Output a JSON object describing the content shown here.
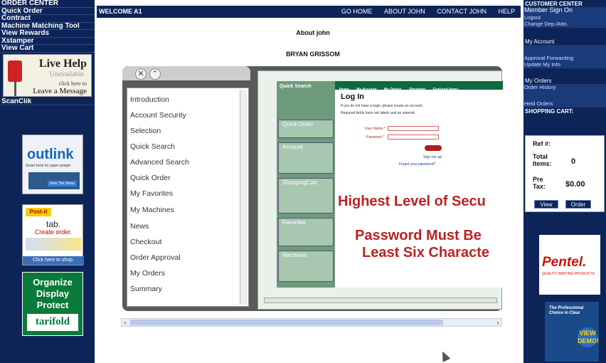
{
  "left_nav": {
    "items": [
      "ORDER CENTER",
      "Quick Order",
      "Contract",
      "Machine Matching Tool",
      "View Rewards",
      "Xstamper",
      "View Cart"
    ],
    "live_help": {
      "title": "Live Help",
      "status": "Unavailable",
      "cta_small": "click here to",
      "cta": "Leave a Message"
    },
    "scanclik": "ScanClik"
  },
  "ads_left": {
    "outlink": {
      "logo": "outlink",
      "tagline": "Smart tools for paper people",
      "demo": "View The Demo"
    },
    "postit": {
      "brand": "Post-it",
      "suffix": "Flags",
      "tab": "tab.",
      "create": "Create order.",
      "shop": "Click here to shop."
    },
    "tarifold": {
      "line1": "Organize",
      "line2": "Display",
      "line3": "Protect",
      "brand": "tarifold"
    }
  },
  "top_bar": {
    "welcome": "WELCOME A1",
    "links": [
      "GO HOME",
      "ABOUT JOHN",
      "CONTACT JOHN",
      "HELP"
    ]
  },
  "main": {
    "title": "About john",
    "subtitle": "BRYAN GRISSOM",
    "toc": [
      "Introduction",
      "Account Security",
      "Selection",
      "Quick Search",
      "Advanced Search",
      "Quick Order",
      "My Favorites",
      "My Machines",
      "News",
      "Checkout",
      "Order Approval",
      "My Orders",
      "Summary"
    ],
    "shot": {
      "nav": [
        "Home",
        "My Account",
        "My Orders",
        "Shopping",
        "Featured Items"
      ],
      "quick_search": "Quick Search",
      "panels": [
        "Quick Order",
        "Account",
        "ShoppingCart",
        "Favorites",
        "Machines"
      ],
      "login_title": "Log In",
      "login_note": "If you do not have a login, please create an account.",
      "required_note": "Required fields have red labels and an asterisk.",
      "user_label": "User Name *",
      "password_label": "Password *",
      "sign_up": "Sign me up!",
      "forgot": "Forgot your password?",
      "big1": "Highest Level of Secu",
      "big2": "Password Must Be",
      "big3": "Least Six Characte"
    }
  },
  "right_nav": {
    "customer_center": "CUSTOMER CENTER",
    "links_a": [
      "Member Sign On",
      "Logout",
      "Change Dep./Attn."
    ],
    "my_account": "My Account",
    "links_b": [
      "Approval Forwarding",
      "Update My Info"
    ],
    "my_orders": "My Orders",
    "links_c": [
      "Order History",
      "Held Orders"
    ],
    "shopping_cart": "SHOPPING CART:",
    "cart": {
      "ref": "Ref #:",
      "total_label": "Total Items:",
      "total_value": "0",
      "pretax_label": "Pre Tax:",
      "pretax_value": "$0.00",
      "view": "View",
      "order": "Order"
    }
  },
  "ads_right": {
    "pentel": {
      "brand": "Pentel.",
      "sub": "QUALITY WRITING PRODUCTS"
    },
    "pentel2": {
      "text": "The Professional Choice in Clear",
      "cta": "VIEW DEMO!"
    }
  },
  "colors": {
    "navy": "#0c2458",
    "accent": "#b21c1c"
  }
}
